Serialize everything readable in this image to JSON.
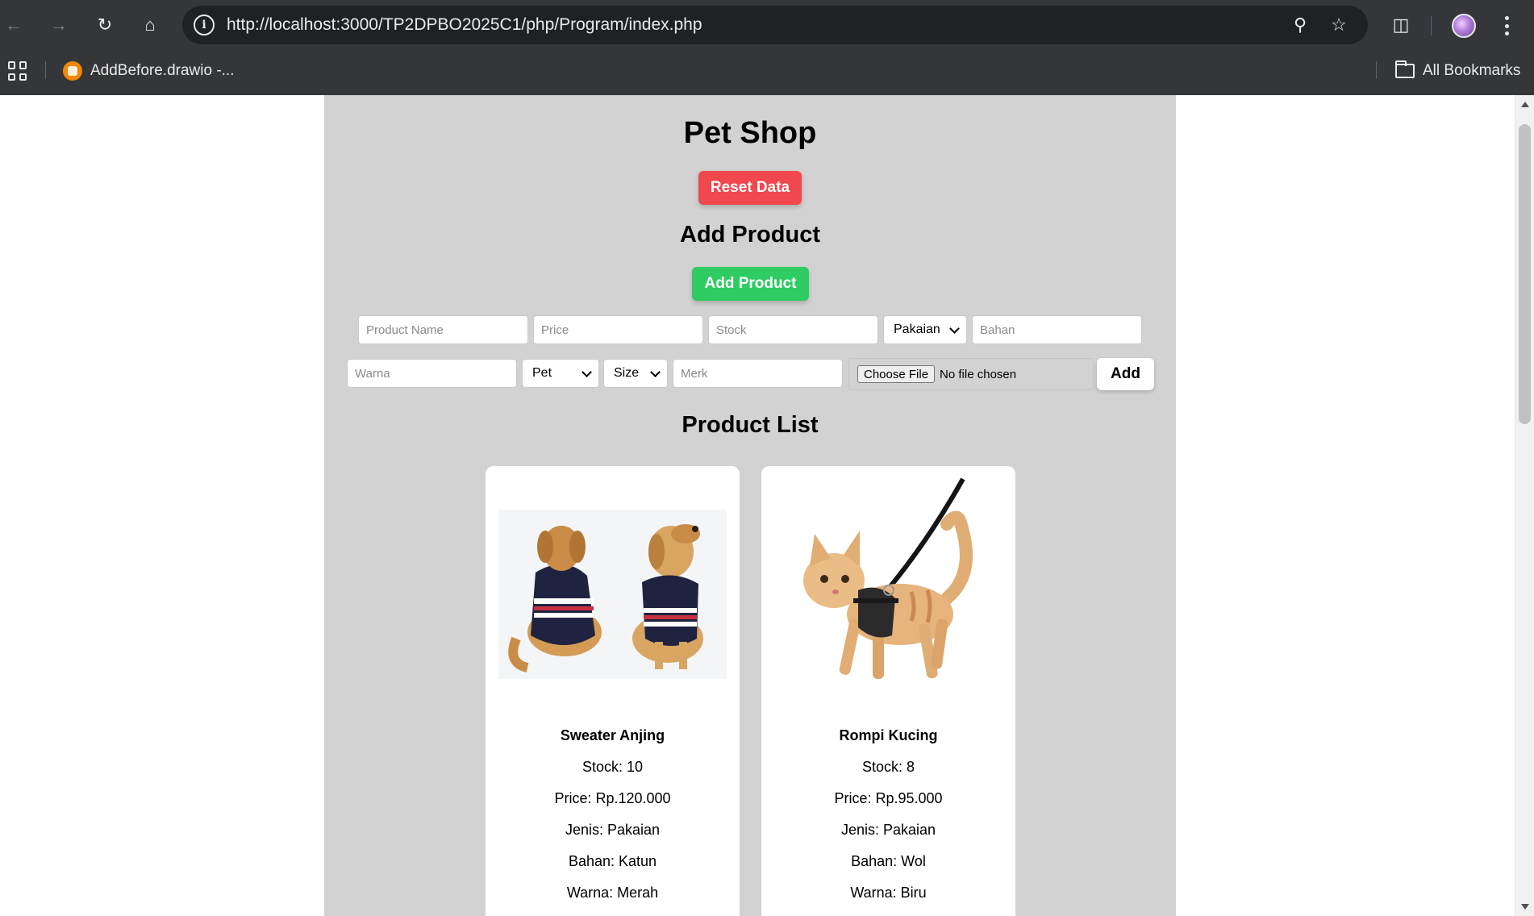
{
  "browser": {
    "url": "http://localhost:3000/TP2DPBO2025C1/php/Program/index.php",
    "bookmark_label": "AddBefore.drawio -...",
    "all_bookmarks_label": "All Bookmarks"
  },
  "page": {
    "title": "Pet Shop",
    "reset_label": "Reset Data",
    "add_section_title": "Add Product",
    "add_product_label": "Add Product",
    "list_section_title": "Product List"
  },
  "form": {
    "product_name_placeholder": "Product Name",
    "price_placeholder": "Price",
    "stock_placeholder": "Stock",
    "jenis_selected": "Pakaian",
    "bahan_placeholder": "Bahan",
    "warna_placeholder": "Warna",
    "pet_selected": "Pet",
    "size_selected": "Size",
    "merk_placeholder": "Merk",
    "choose_file_label": "Choose File",
    "file_status": "No file chosen",
    "add_label": "Add"
  },
  "products": [
    {
      "name": "Sweater Anjing",
      "stock": "Stock: 10",
      "price": "Price: Rp.120.000",
      "jenis": "Jenis: Pakaian",
      "bahan": "Bahan: Katun",
      "warna": "Warna: Merah",
      "image": "dog-sweater-image"
    },
    {
      "name": "Rompi Kucing",
      "stock": "Stock: 8",
      "price": "Price: Rp.95.000",
      "jenis": "Jenis: Pakaian",
      "bahan": "Bahan: Wol",
      "warna": "Warna: Biru",
      "image": "cat-harness-image"
    }
  ],
  "colors": {
    "reset": "#f0484e",
    "add_product": "#2ecc63",
    "container_bg": "#d2d2d2"
  }
}
